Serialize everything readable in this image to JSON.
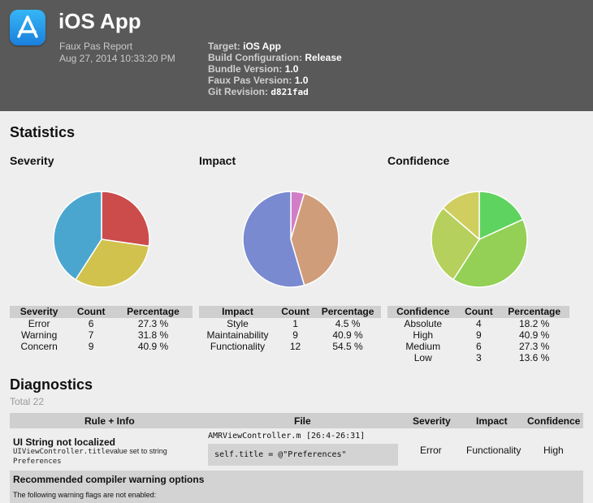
{
  "header": {
    "app_title": "iOS App",
    "report_name": "Faux Pas Report",
    "report_date": "Aug 27, 2014 10:33:20 PM",
    "target_label": "Target:",
    "target_value": "iOS App",
    "build_config_label": "Build Configuration:",
    "build_config_value": "Release",
    "bundle_version_label": "Bundle Version:",
    "bundle_version_value": "1.0",
    "fauxpas_version_label": "Faux Pas Version:",
    "fauxpas_version_value": "1.0",
    "git_revision_label": "Git Revision:",
    "git_revision_value": "d821fad",
    "app_icon": "app-store-icon"
  },
  "statistics": {
    "title": "Statistics",
    "severity": {
      "title": "Severity",
      "columns": [
        "Severity",
        "Count",
        "Percentage"
      ],
      "rows": [
        {
          "name": "Error",
          "count": "6",
          "pct": "27.3 %"
        },
        {
          "name": "Warning",
          "count": "7",
          "pct": "31.8 %"
        },
        {
          "name": "Concern",
          "count": "9",
          "pct": "40.9 %"
        }
      ]
    },
    "impact": {
      "title": "Impact",
      "columns": [
        "Impact",
        "Count",
        "Percentage"
      ],
      "rows": [
        {
          "name": "Style",
          "count": "1",
          "pct": "4.5 %"
        },
        {
          "name": "Maintainability",
          "count": "9",
          "pct": "40.9 %"
        },
        {
          "name": "Functionality",
          "count": "12",
          "pct": "54.5 %"
        }
      ]
    },
    "confidence": {
      "title": "Confidence",
      "columns": [
        "Confidence",
        "Count",
        "Percentage"
      ],
      "rows": [
        {
          "name": "Absolute",
          "count": "4",
          "pct": "18.2 %"
        },
        {
          "name": "High",
          "count": "9",
          "pct": "40.9 %"
        },
        {
          "name": "Medium",
          "count": "6",
          "pct": "27.3 %"
        },
        {
          "name": "Low",
          "count": "3",
          "pct": "13.6 %"
        }
      ]
    }
  },
  "chart_data": [
    {
      "type": "pie",
      "categories": [
        "Error",
        "Warning",
        "Concern"
      ],
      "values": [
        6,
        7,
        9
      ],
      "colors": [
        "#cc4b4b",
        "#d1c24e",
        "#4ba6cf"
      ]
    },
    {
      "type": "pie",
      "categories": [
        "Style",
        "Maintainability",
        "Functionality"
      ],
      "values": [
        1,
        9,
        12
      ],
      "colors": [
        "#d17ec7",
        "#d09d7a",
        "#7a8ad0"
      ]
    },
    {
      "type": "pie",
      "categories": [
        "Absolute",
        "High",
        "Medium",
        "Low"
      ],
      "values": [
        4,
        9,
        6,
        3
      ],
      "colors": [
        "#5fd35f",
        "#93d055",
        "#b5d05c",
        "#cfce5e"
      ]
    }
  ],
  "diagnostics": {
    "title": "Diagnostics",
    "total": "Total 22",
    "columns": [
      "Rule + Info",
      "File",
      "Severity",
      "Impact",
      "Confidence"
    ],
    "item": {
      "rule": "UI String not localized",
      "info_code": "UIViewController.title",
      "info_text": "value set to string",
      "info_code2": "Preferences",
      "file": "AMRViewController.m",
      "range": "[26:4-26:31]",
      "snippet": "self.title = @\"Preferences\"",
      "severity": "Error",
      "impact": "Functionality",
      "confidence": "High"
    },
    "recommended": {
      "title": "Recommended compiler warning options",
      "text": "The following warning flags are not enabled:"
    }
  }
}
